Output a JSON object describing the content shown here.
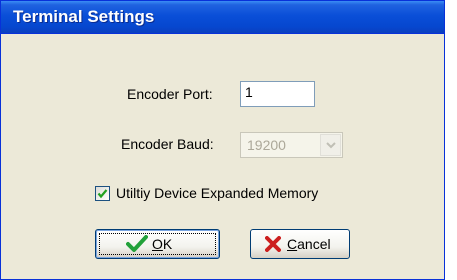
{
  "window": {
    "title": "Terminal Settings"
  },
  "form": {
    "encoder_port": {
      "label": "Encoder Port:",
      "value": "1"
    },
    "encoder_baud": {
      "label": "Encoder Baud:",
      "value": "19200",
      "enabled": false
    },
    "expanded_memory": {
      "label": "Utiltiy Device Expanded Memory",
      "checked": true
    }
  },
  "buttons": {
    "ok": {
      "mnemonic": "O",
      "rest": "K",
      "icon": "checkmark-icon"
    },
    "cancel": {
      "mnemonic": "C",
      "rest": "ancel",
      "icon": "red-x-icon"
    }
  },
  "colors": {
    "titlebar": "#0a4fd8",
    "dialog_bg": "#ece9d8",
    "ok_icon": "#22a13a",
    "cancel_icon": "#cc1f1f"
  }
}
